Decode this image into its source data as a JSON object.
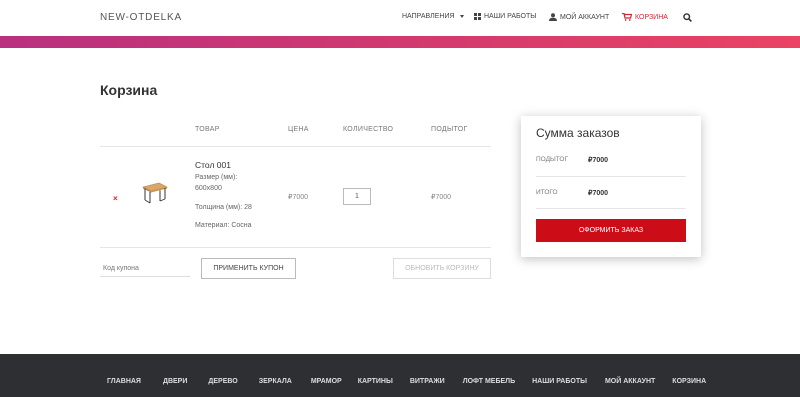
{
  "header": {
    "logo": "NEW-OTDELKA",
    "nav": {
      "directions": "Направления",
      "works": "Наши работы",
      "account": "Мой аккаунт",
      "cart": "Корзина"
    }
  },
  "colors": {
    "accent_red": "#cc0d18",
    "gradient_start": "#b8307f",
    "gradient_end": "#ea4364",
    "footer_bg": "#2e2f33"
  },
  "page": {
    "title": "Корзина"
  },
  "cart": {
    "columns": [
      "Товар",
      "Цена",
      "Количество",
      "Подытог"
    ],
    "items": [
      {
        "remove": "×",
        "name": "Стол 001",
        "size_label": "Размер (мм):",
        "size_value": "600х800",
        "thickness_label": "Толщина (мм):",
        "thickness_value": "28",
        "material_label": "Материал:",
        "material_value": "Сосна",
        "price": "₽7000",
        "quantity": "1",
        "subtotal": "₽7000"
      }
    ],
    "coupon_placeholder": "Код купона",
    "apply_coupon": "Применить купон",
    "update_cart": "Обновить корзину"
  },
  "summary": {
    "title": "Сумма заказов",
    "subtotal_label": "Подытог",
    "subtotal_value": "₽7000",
    "total_label": "Итого",
    "total_value": "₽7000",
    "checkout": "Оформить заказ"
  },
  "footer": {
    "links": [
      "Главная",
      "Двери",
      "Дерево",
      "Зеркала",
      "Мрамор",
      "Картины",
      "Витражи",
      "Лофт мебель",
      "Наши работы",
      "Мой аккаунт",
      "Корзина"
    ]
  }
}
